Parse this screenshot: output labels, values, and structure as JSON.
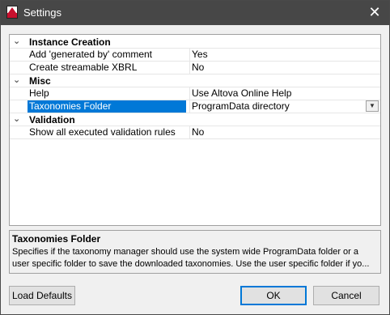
{
  "window": {
    "title": "Settings",
    "icon": "altova-wip-icon"
  },
  "grid": {
    "categories": [
      {
        "label": "Instance Creation",
        "properties": [
          {
            "name": "Add 'generated by' comment",
            "value": "Yes"
          },
          {
            "name": "Create streamable XBRL",
            "value": "No"
          }
        ]
      },
      {
        "label": "Misc",
        "properties": [
          {
            "name": "Help",
            "value": "Use Altova Online Help"
          },
          {
            "name": "Taxonomies Folder",
            "value": "ProgramData directory",
            "selected": true
          }
        ]
      },
      {
        "label": "Validation",
        "properties": [
          {
            "name": "Show all executed validation rules",
            "value": "No"
          }
        ]
      }
    ]
  },
  "description": {
    "title": "Taxonomies Folder",
    "line1": "Specifies if the taxonomy manager should use the system wide ProgramData folder or a",
    "line2": "user specific folder to save the downloaded taxonomies. Use the user specific folder if yo..."
  },
  "buttons": {
    "load_defaults": "Load Defaults",
    "ok": "OK",
    "cancel": "Cancel"
  },
  "colors": {
    "titlebar": "#474747",
    "selection": "#0078d7"
  }
}
